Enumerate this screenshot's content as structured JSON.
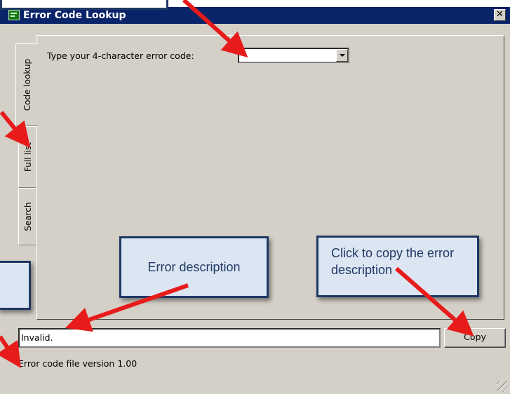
{
  "window": {
    "title": "Error Code Lookup",
    "close_glyph": "✕"
  },
  "tabs": [
    {
      "label": "Code lookup",
      "active": true
    },
    {
      "label": "Full list",
      "active": false
    },
    {
      "label": "Search",
      "active": false
    }
  ],
  "lookup": {
    "prompt": "Type your 4-character error code:",
    "code_value": ""
  },
  "result": {
    "description": "Invalid.",
    "copy_label": "Copy"
  },
  "status": {
    "text": "Error code file version 1.00"
  },
  "callouts": {
    "description_note": "Error description",
    "copy_note": "Click to copy the error description"
  },
  "colors": {
    "titlebar": "#0a246a",
    "window": "#d4d0c8",
    "callout_fill": "#dce6f2",
    "callout_border": "#1f3864",
    "arrow": "#e81b1b"
  },
  "icons": {
    "app": "app-icon",
    "close": "close-icon",
    "dropdown": "chevron-down-icon",
    "resize": "resize-grip-icon"
  }
}
